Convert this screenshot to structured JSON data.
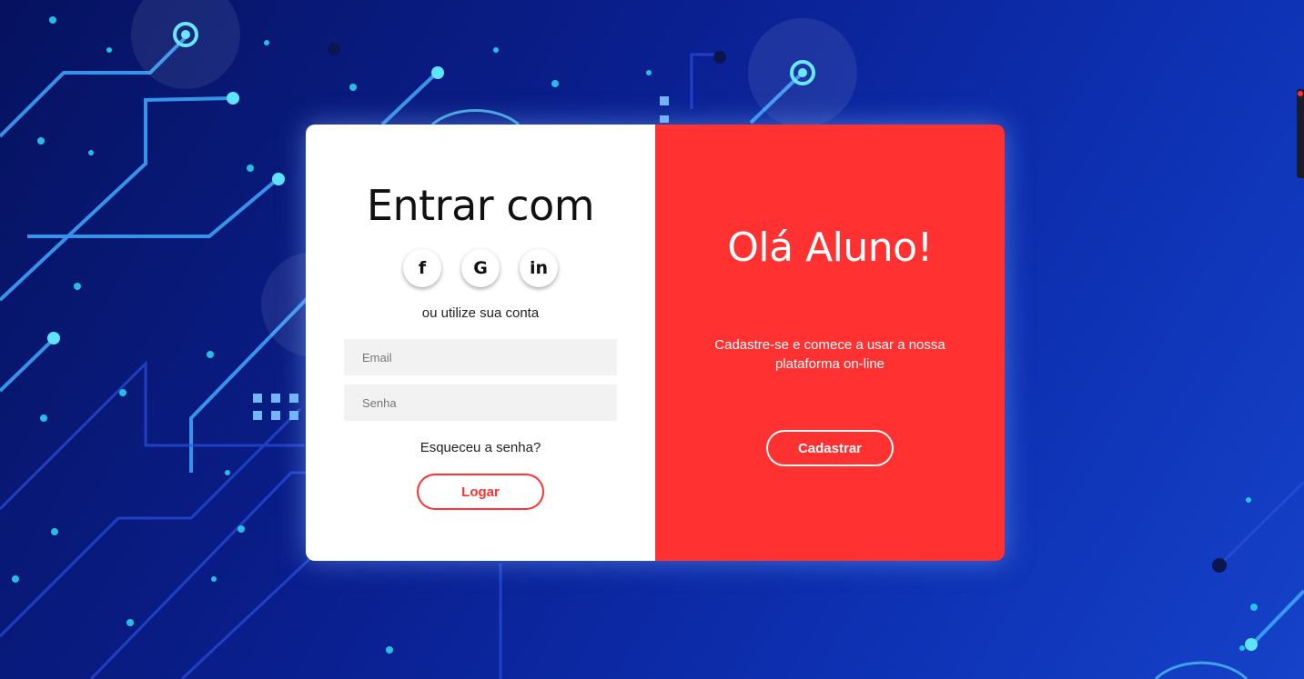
{
  "login": {
    "title": "Entrar com",
    "social": [
      {
        "icon": "facebook-icon",
        "glyph": "f"
      },
      {
        "icon": "google-icon",
        "glyph": "G"
      },
      {
        "icon": "linkedin-icon",
        "glyph": "in"
      }
    ],
    "alt_text": "ou utilize sua conta",
    "email_placeholder": "Email",
    "password_placeholder": "Senha",
    "forgot_label": "Esqueceu a senha?",
    "login_button": "Logar"
  },
  "register": {
    "title": "Olá Aluno!",
    "text": "Cadastre-se e comece a usar a nossa plataforma on-line",
    "register_button": "Cadastrar"
  },
  "colors": {
    "accent": "#ff3131",
    "panel_left": "#ffffff",
    "background": "#0a1f8f"
  }
}
